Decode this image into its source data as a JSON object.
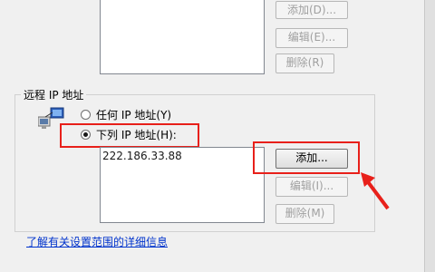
{
  "local_section": {
    "add_button": "添加(D)...",
    "edit_button": "编辑(E)...",
    "remove_button": "删除(R)"
  },
  "remote_section": {
    "group_title": "远程 IP 地址",
    "radio_any": "任何 IP 地址(Y)",
    "radio_list": "下列 IP 地址(H):",
    "selected_option": "list",
    "ip_entries": [
      "222.186.33.88"
    ],
    "add_button": "添加...",
    "edit_button": "编辑(I)...",
    "remove_button": "删除(M)"
  },
  "footer": {
    "help_link": "了解有关设置范围的详细信息"
  },
  "colors": {
    "highlight": "#e8201a",
    "link": "#0033cc"
  },
  "icons": [
    "network-computers-icon",
    "arrow-icon"
  ]
}
